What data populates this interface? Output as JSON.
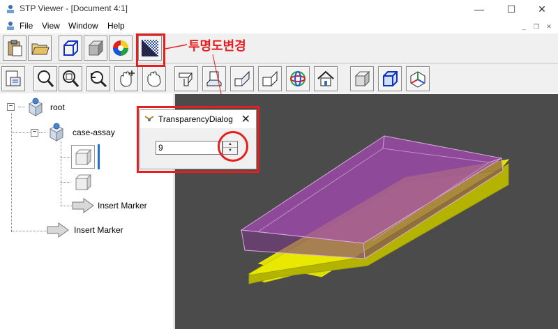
{
  "window": {
    "title": "STP Viewer - [Document 4:1]",
    "controls": {
      "minimize": "—",
      "maximize": "☐",
      "close": "✕"
    }
  },
  "menu": {
    "items": [
      "File",
      "View",
      "Window",
      "Help"
    ],
    "mdi": {
      "minimize": "_",
      "restore": "❐",
      "close": "✕"
    }
  },
  "toolbar1": {
    "buttons": [
      "paste-icon",
      "open-folder-icon",
      "wireframe-cube-icon",
      "shaded-cube-icon",
      "color-wheel-icon",
      "transparency-icon"
    ]
  },
  "toolbar2": {
    "buttons": [
      "tree-view-icon",
      "zoom-icon",
      "zoom-window-icon",
      "rotate-icon",
      "pan-icon",
      "hand-icon",
      "view-front-icon",
      "view-top-icon",
      "view-left-icon",
      "view-right-icon",
      "view-axo-icon",
      "view-home-icon",
      "shaded-mode-icon",
      "wireframe-mode-icon",
      "axis-triad-icon"
    ]
  },
  "annotation": {
    "label": "투명도변경"
  },
  "tree": {
    "root": "root",
    "assembly": "case-assay",
    "marker1": "Insert Marker",
    "marker2": "Insert Marker",
    "toggle_root": "−",
    "toggle_assembly": "−"
  },
  "dialog": {
    "title": "TransparencyDialog",
    "close": "✕",
    "value": "9",
    "spin_up": "▲",
    "spin_down": "▼"
  },
  "colors": {
    "annotation": "#e61e1e",
    "viewport_bg": "#4b4b4b",
    "model_base": "#e8e800",
    "model_lid": "#9a4aa6",
    "selection": "#1a6fd0"
  }
}
